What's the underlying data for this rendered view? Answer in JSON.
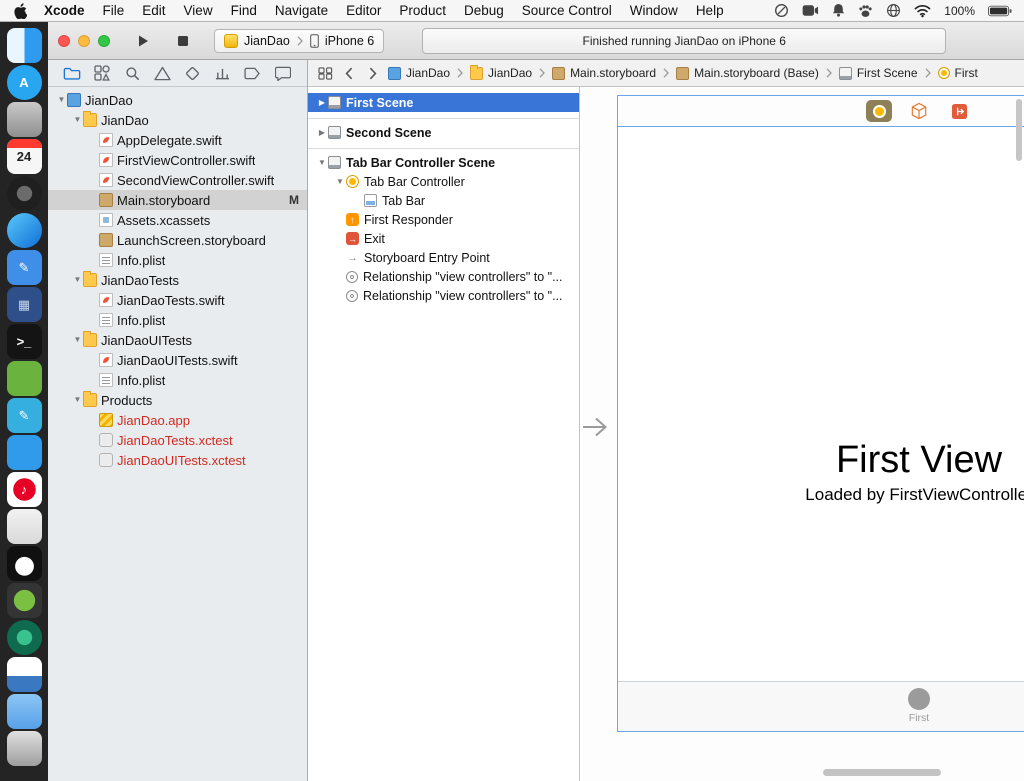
{
  "menu_bar": {
    "app_menu": "Xcode",
    "menus": [
      "File",
      "Edit",
      "View",
      "Find",
      "Navigate",
      "Editor",
      "Product",
      "Debug",
      "Source Control",
      "Window",
      "Help"
    ],
    "status_icons": [
      "circle-x-icon",
      "camera-icon",
      "bell-icon",
      "paw-icon",
      "globe-icon",
      "wifi-icon"
    ],
    "battery_percent": "100%"
  },
  "toolbar": {
    "scheme_name": "JianDao",
    "scheme_device": "iPhone 6",
    "status_message": "Finished running JianDao on iPhone 6"
  },
  "nav_toolbar": [
    {
      "name": "project-navigator-icon",
      "icon": "navFolder",
      "active": true
    },
    {
      "name": "symbol-navigator-icon",
      "icon": "navSym"
    },
    {
      "name": "find-navigator-icon",
      "icon": "navFind"
    },
    {
      "name": "issue-navigator-icon",
      "icon": "navWarn"
    },
    {
      "name": "test-navigator-icon",
      "icon": "navTest"
    },
    {
      "name": "debug-navigator-icon",
      "icon": "navDebug"
    },
    {
      "name": "breakpoint-navigator-icon",
      "icon": "navBp"
    },
    {
      "name": "report-navigator-icon",
      "icon": "navRep"
    }
  ],
  "project_tree": [
    {
      "label": "JianDao",
      "icon": "project",
      "level": 0,
      "expanded": true
    },
    {
      "label": "JianDao",
      "icon": "folder",
      "level": 1,
      "expanded": true
    },
    {
      "label": "AppDelegate.swift",
      "icon": "swift",
      "level": 2
    },
    {
      "label": "FirstViewController.swift",
      "icon": "swift",
      "level": 2
    },
    {
      "label": "SecondViewController.swift",
      "icon": "swift",
      "level": 2
    },
    {
      "label": "Main.storyboard",
      "icon": "storyboard",
      "level": 2,
      "selected": true,
      "badge": "M"
    },
    {
      "label": "Assets.xcassets",
      "icon": "assets",
      "level": 2
    },
    {
      "label": "LaunchScreen.storyboard",
      "icon": "storyboard",
      "level": 2
    },
    {
      "label": "Info.plist",
      "icon": "plist",
      "level": 2
    },
    {
      "label": "JianDaoTests",
      "icon": "folder",
      "level": 1,
      "expanded": true
    },
    {
      "label": "JianDaoTests.swift",
      "icon": "swift",
      "level": 2
    },
    {
      "label": "Info.plist",
      "icon": "plist",
      "level": 2
    },
    {
      "label": "JianDaoUITests",
      "icon": "folder",
      "level": 1,
      "expanded": true
    },
    {
      "label": "JianDaoUITests.swift",
      "icon": "swift",
      "level": 2
    },
    {
      "label": "Info.plist",
      "icon": "plist",
      "level": 2
    },
    {
      "label": "Products",
      "icon": "folder",
      "level": 1,
      "expanded": true
    },
    {
      "label": "JianDao.app",
      "icon": "app",
      "level": 2,
      "missing": true
    },
    {
      "label": "JianDaoTests.xctest",
      "icon": "xctest",
      "level": 2,
      "missing": true
    },
    {
      "label": "JianDaoUITests.xctest",
      "icon": "xctest",
      "level": 2,
      "missing": true
    }
  ],
  "jump_bar": {
    "segments": [
      {
        "label": "JianDao",
        "icon": "project"
      },
      {
        "label": "JianDao",
        "icon": "folder"
      },
      {
        "label": "Main.storyboard",
        "icon": "storyboard"
      },
      {
        "label": "Main.storyboard (Base)",
        "icon": "storyboard"
      },
      {
        "label": "First Scene",
        "icon": "scene"
      },
      {
        "label": "First",
        "icon": "tab-item"
      }
    ]
  },
  "outline": [
    {
      "label": "First Scene",
      "icon": "scene",
      "bold": true,
      "selected": true,
      "disclosure": "collapsed",
      "level": 0
    },
    {
      "label": "Second Scene",
      "icon": "scene",
      "bold": true,
      "disclosure": "collapsed",
      "level": 0,
      "divider_above": true
    },
    {
      "label": "Tab Bar Controller Scene",
      "icon": "scene",
      "bold": true,
      "disclosure": "expanded",
      "level": 0,
      "divider_above": true
    },
    {
      "label": "Tab Bar Controller",
      "icon": "tab-bar-controller",
      "level": 1,
      "disclosure": "expanded"
    },
    {
      "label": "Tab Bar",
      "icon": "tab-bar",
      "level": 2
    },
    {
      "label": "First Responder",
      "icon": "first-responder",
      "level": 1
    },
    {
      "label": "Exit",
      "icon": "exit",
      "level": 1
    },
    {
      "label": "Storyboard Entry Point",
      "icon": "entry-point",
      "level": 1
    },
    {
      "label": "Relationship \"view controllers\" to \"...",
      "icon": "relationship",
      "level": 1
    },
    {
      "label": "Relationship \"view controllers\" to \"...",
      "icon": "relationship",
      "level": 1
    }
  ],
  "canvas": {
    "scene_title": "First View",
    "scene_subtitle": "Loaded by FirstViewController",
    "tab_item_label": "First",
    "selection_color": "#6aa6e8"
  },
  "dock": [
    {
      "name": "finder-icon",
      "bg": "linear-gradient(90deg,#eaf6ff 50%,#2f9bf0 50%)"
    },
    {
      "name": "app-store-icon",
      "bg": "#28a7f0",
      "glyph": "A",
      "fg": "#fff",
      "shape": "circle"
    },
    {
      "name": "gray-app-icon",
      "bg": "linear-gradient(#c9c9c9,#8f8f8f)"
    },
    {
      "name": "calendar-icon",
      "bg": "#f6f6f6",
      "glyph": "24",
      "fg": "#222",
      "strip": "#ff3b30"
    },
    {
      "name": "lens-app-icon",
      "bg": "radial-gradient(circle,#6b6b6b 0 30%,#1f1f1f 32%)",
      "shape": "circle"
    },
    {
      "name": "safari-icon",
      "bg": "linear-gradient(135deg,#5ac8fa,#0f6fd7)",
      "shape": "circle"
    },
    {
      "name": "notes-app-icon",
      "bg": "#3f8fe8",
      "glyph": "✎",
      "fg": "#fff"
    },
    {
      "name": "grid-app-icon",
      "bg": "#2e4f8a",
      "glyph": "▦",
      "fg": "#c7d6ef"
    },
    {
      "name": "terminal-icon",
      "bg": "#141414",
      "glyph": ">_",
      "fg": "#fff"
    },
    {
      "name": "evernote-icon",
      "bg": "#69b33e"
    },
    {
      "name": "writer-app-icon",
      "bg": "#35aee0",
      "glyph": "✎",
      "fg": "#fff"
    },
    {
      "name": "people-app-icon",
      "bg": "#2f9bea"
    },
    {
      "name": "music-app-icon",
      "bg": "radial-gradient(circle,#e60026 0 45%,#fff 46%)",
      "glyph": "♪",
      "fg": "#fff"
    },
    {
      "name": "light-app-icon",
      "bg": "linear-gradient(#f2f2f2,#d9d9d9)"
    },
    {
      "name": "qq-icon",
      "bg": "radial-gradient(circle at 50% 58%,#fff 0 34%,#101010 36%)"
    },
    {
      "name": "android-app-icon",
      "bg": "radial-gradient(circle,#7bc043 0 42%,#343434 44%)"
    },
    {
      "name": "atom-app-icon",
      "bg": "radial-gradient(circle,#39c28f 0 30%,#0f6b4e 32%)",
      "shape": "circle"
    },
    {
      "name": "box-app-icon",
      "bg": "linear-gradient(#ffffff 55%,#3a78c2 55%)"
    },
    {
      "name": "folder-dock-icon",
      "bg": "linear-gradient(#8cc6f5,#58a0e8)"
    },
    {
      "name": "trash-icon",
      "bg": "linear-gradient(#e0e0e0,#9e9e9e)"
    }
  ]
}
